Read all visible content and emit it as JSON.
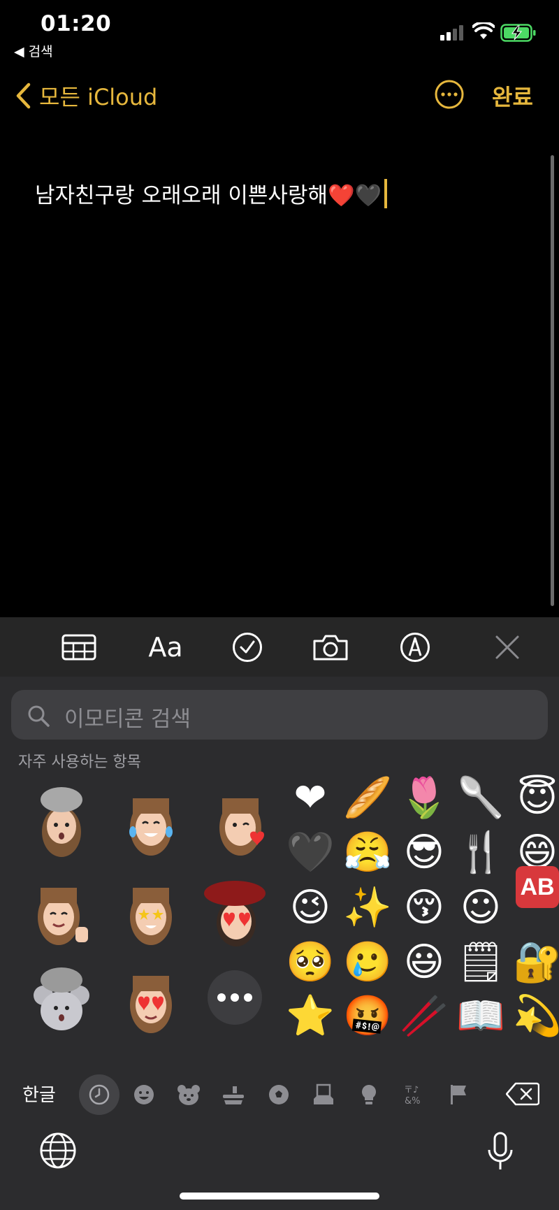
{
  "status": {
    "time": "01:20",
    "back_app": "◀ 검색"
  },
  "nav": {
    "back_label": "모든 iCloud",
    "done_label": "완료"
  },
  "note": {
    "text": "남자친구랑 오래오래 이쁜사랑해❤️🖤"
  },
  "toolbar": {
    "format_label": "Aa"
  },
  "keyboard": {
    "search_placeholder": "이모티콘 검색",
    "section_title": "자주 사용하는 항목",
    "emoji_rows": [
      [
        "❤",
        "🥖",
        "🌷",
        "🥄",
        "😇"
      ],
      [
        "🖤",
        "😤",
        "😎",
        "🍴",
        "😄"
      ],
      [
        "😉",
        "✨",
        "😚",
        "☺",
        "🆎"
      ],
      [
        "🥺",
        "🥲",
        "😃",
        "🗒",
        "🔐"
      ],
      [
        "⭐",
        "🤬",
        "🥢",
        "📖",
        "💫"
      ]
    ],
    "ab_label": "AB",
    "lang_label": "한글",
    "categories": [
      "clock-icon",
      "smiley-icon",
      "bear-icon",
      "food-icon",
      "ball-icon",
      "building-icon",
      "lightbulb-icon",
      "symbols-icon",
      "flag-icon"
    ],
    "symbols_cat_label": "〒♪ &%"
  },
  "colors": {
    "accent": "#e6b73d",
    "keyboard_bg": "#2c2c2e",
    "toolbar_bg": "#262626"
  }
}
